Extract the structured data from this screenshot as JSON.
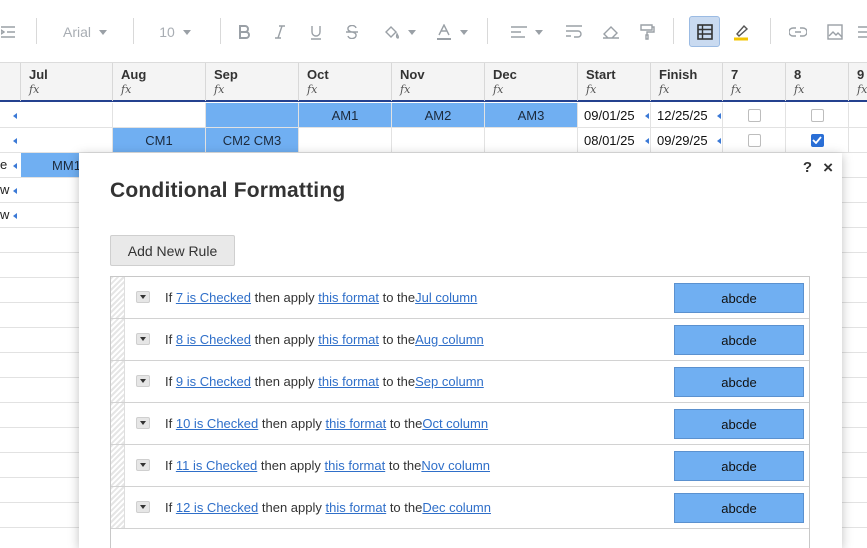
{
  "toolbar": {
    "font_name": "Arial",
    "font_size": "10"
  },
  "columns": [
    {
      "key": "jul",
      "label": "Jul"
    },
    {
      "key": "aug",
      "label": "Aug"
    },
    {
      "key": "sep",
      "label": "Sep"
    },
    {
      "key": "oct",
      "label": "Oct"
    },
    {
      "key": "nov",
      "label": "Nov"
    },
    {
      "key": "dec",
      "label": "Dec"
    },
    {
      "key": "start",
      "label": "Start"
    },
    {
      "key": "finish",
      "label": "Finish"
    },
    {
      "key": "c7",
      "label": "7"
    },
    {
      "key": "c8",
      "label": "8"
    },
    {
      "key": "c9",
      "label": "9"
    }
  ],
  "fx_symbol": "fx",
  "rows": {
    "r1": {
      "oct": "AM1",
      "nov": "AM2",
      "dec": "AM3",
      "start": "09/01/25",
      "finish": "12/25/25",
      "c7": false,
      "c8": false
    },
    "r2": {
      "aug": "CM1",
      "sep": "CM2 CM3",
      "start": "08/01/25",
      "finish": "09/29/25",
      "c7": false,
      "c8": true
    },
    "r3": {
      "label": "e",
      "jul": "MM1"
    },
    "r4": {
      "label": "w"
    },
    "r5": {
      "label": "w"
    }
  },
  "dialog": {
    "title": "Conditional Formatting",
    "help": "?",
    "close": "×",
    "add_button": "Add New Rule",
    "rules": [
      {
        "if": "If",
        "condition": "7 is Checked",
        "then": "then apply",
        "format": "this format",
        "to": "to the",
        "target": "Jul column",
        "preview": "abcde"
      },
      {
        "if": "If",
        "condition": "8 is Checked",
        "then": "then apply",
        "format": "this format",
        "to": "to the",
        "target": "Aug column",
        "preview": "abcde"
      },
      {
        "if": "If",
        "condition": "9 is Checked",
        "then": "then apply",
        "format": "this format",
        "to": "to the",
        "target": "Sep column",
        "preview": "abcde"
      },
      {
        "if": "If",
        "condition": "10 is Checked",
        "then": "then apply",
        "format": "this format",
        "to": "to the",
        "target": "Oct column",
        "preview": "abcde"
      },
      {
        "if": "If",
        "condition": "11 is Checked",
        "then": "then apply",
        "format": "this format",
        "to": "to the",
        "target": "Nov column",
        "preview": "abcde"
      },
      {
        "if": "If",
        "condition": "12 is Checked",
        "then": "then apply",
        "format": "this format",
        "to": "to the",
        "target": "Dec column",
        "preview": "abcde"
      }
    ]
  },
  "colors": {
    "highlight_blue": "#70aff2",
    "link_blue": "#2f6fc9",
    "checkbox_checked": "#2a6fd6",
    "header_underline": "#24418f"
  }
}
